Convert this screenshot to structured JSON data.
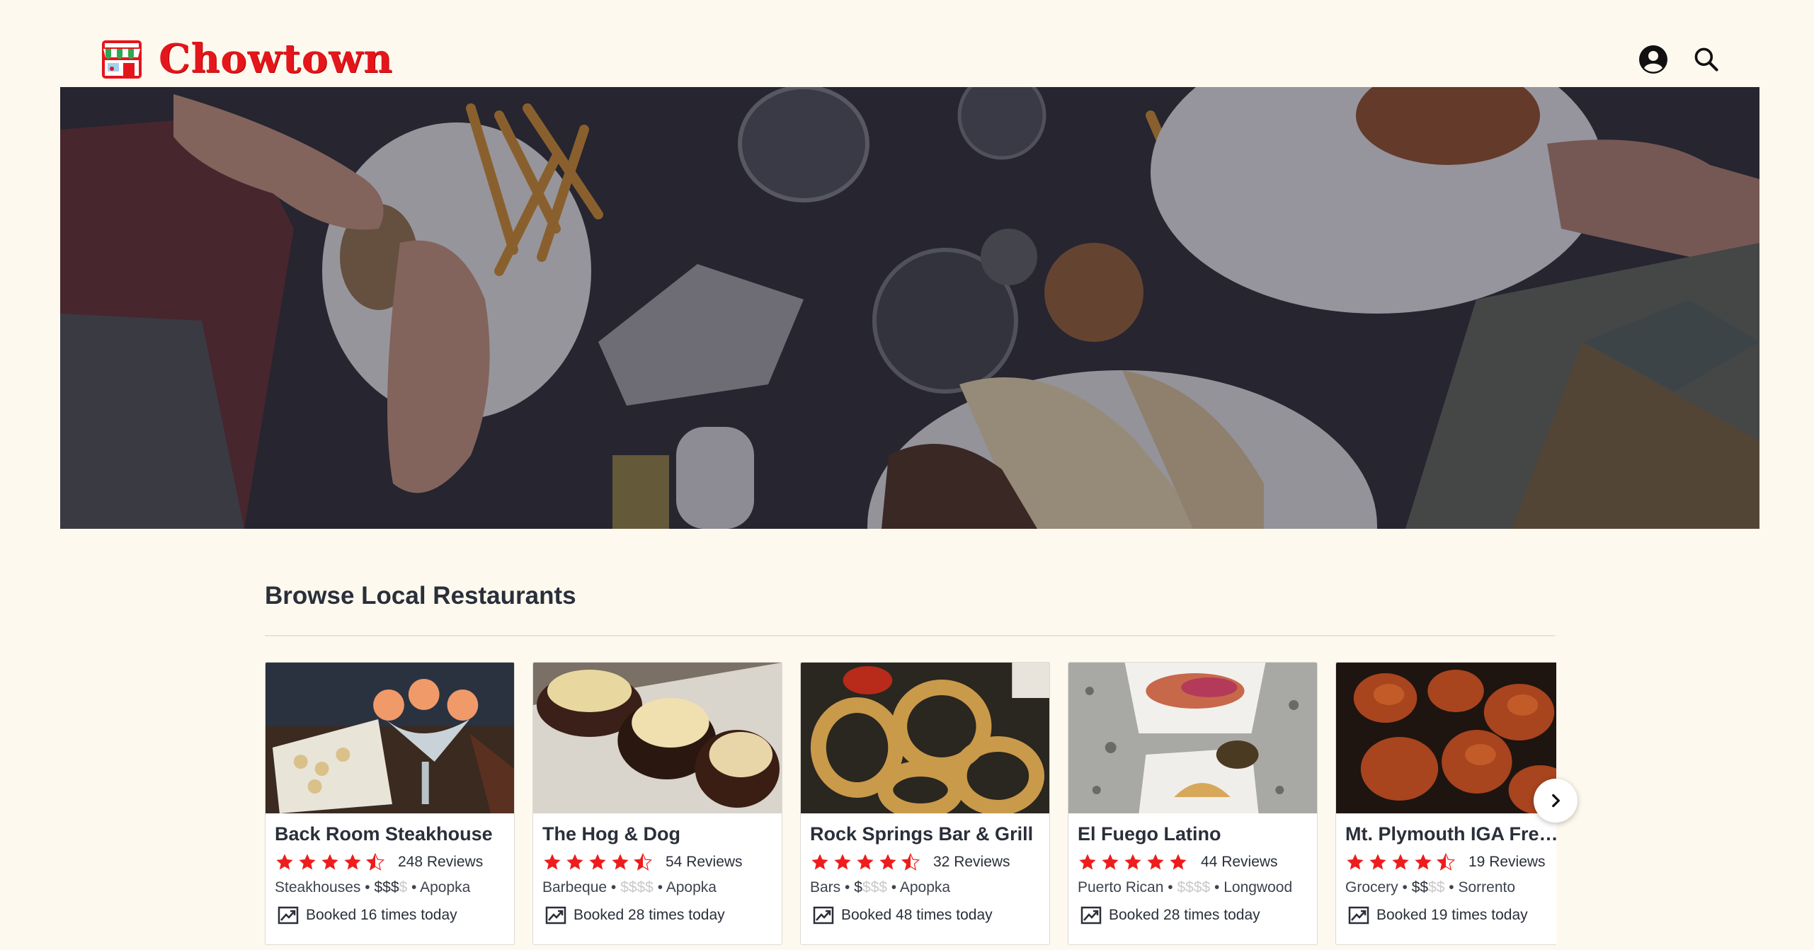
{
  "brand": {
    "name": "Chowtown",
    "color": "#e4161c"
  },
  "header": {
    "icons": [
      "account-icon",
      "search-icon"
    ]
  },
  "browse": {
    "title": "Browse Local Restaurants",
    "next_icon": "chevron-right-icon"
  },
  "restaurants": [
    {
      "name": "Back Room Steakhouse",
      "rating": 4.5,
      "reviews": "248 Reviews",
      "category": "Steakhouses",
      "price_level": 3,
      "price_max": 4,
      "city": "Apopka",
      "booked": "Booked 16 times today"
    },
    {
      "name": "The Hog & Dog",
      "rating": 4.5,
      "reviews": "54 Reviews",
      "category": "Barbeque",
      "price_level": 0,
      "price_max": 4,
      "city": "Apopka",
      "booked": "Booked 28 times today"
    },
    {
      "name": "Rock Springs Bar & Grill",
      "rating": 4.5,
      "reviews": "32 Reviews",
      "category": "Bars",
      "price_level": 1,
      "price_max": 4,
      "city": "Apopka",
      "booked": "Booked 48 times today"
    },
    {
      "name": "El Fuego Latino",
      "rating": 5,
      "reviews": "44 Reviews",
      "category": "Puerto Rican",
      "price_level": 0,
      "price_max": 4,
      "city": "Longwood",
      "booked": "Booked 28 times today"
    },
    {
      "name": "Mt. Plymouth IGA Fresh Market",
      "rating": 4.5,
      "reviews": "19 Reviews",
      "category": "Grocery",
      "price_level": 2,
      "price_max": 4,
      "city": "Sorrento",
      "booked": "Booked 19 times today"
    }
  ],
  "colors": {
    "star": "#ee1c1c",
    "background": "#fdf9ee"
  }
}
